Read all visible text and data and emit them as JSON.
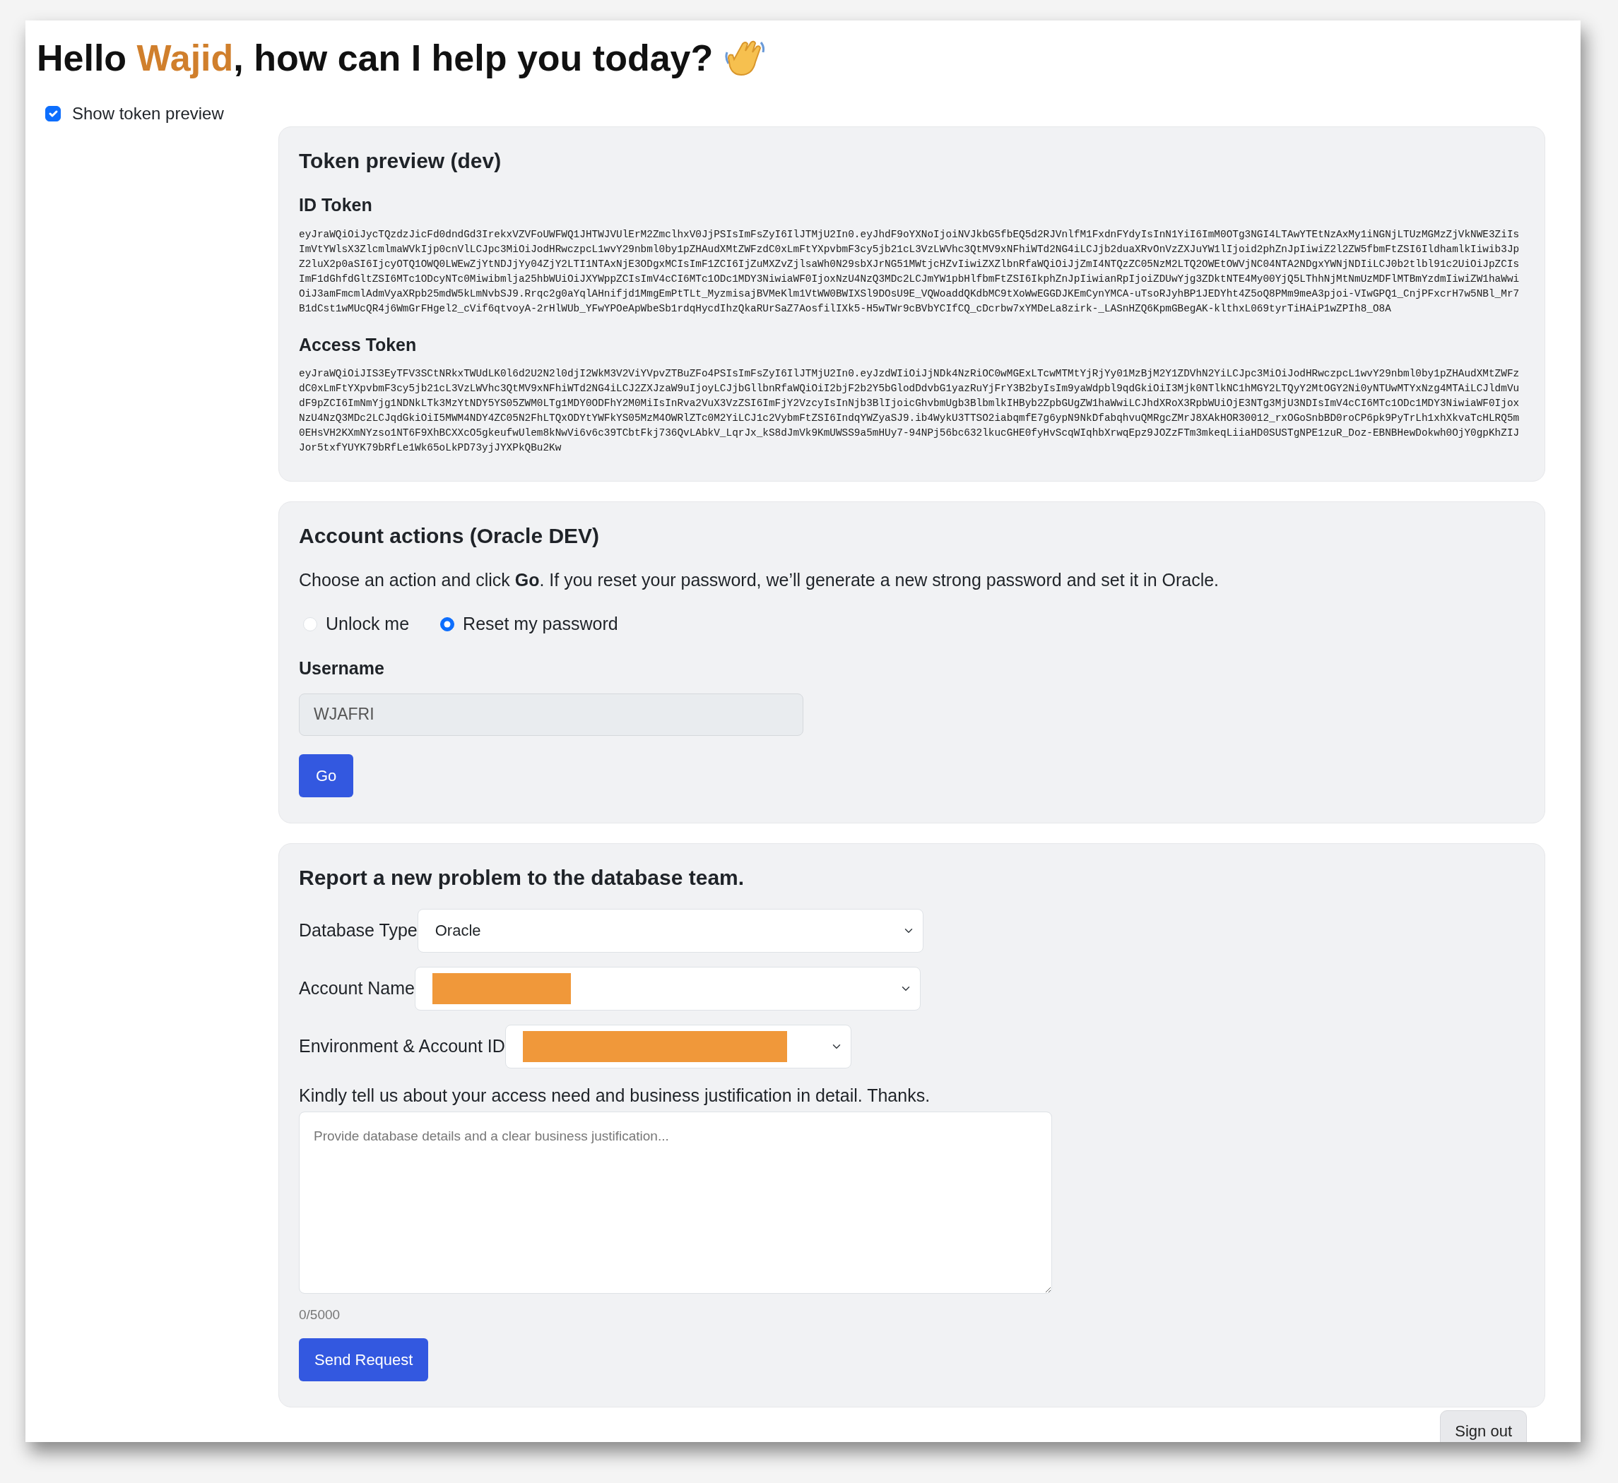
{
  "greeting": {
    "before": "Hello ",
    "name": "Wajid",
    "after": ", how can I help you today?"
  },
  "show_token_preview": {
    "label": "Show token preview",
    "checked": true
  },
  "token_preview": {
    "title": "Token preview (dev)",
    "tokens": [
      {
        "label": "ID Token",
        "value": "eyJraWQiOiJycTQzdzJicFd0dndGd3IrekxVZVFoUWFWQ1JHTWJVUlErM2ZmclhxV0JjPSIsImFsZyI6IlJTMjU2In0.eyJhdF9oYXNoIjoiNVJkbG5fbEQ5d2RJVnlfM1FxdnFYdyIsInN1YiI6ImM0OTg3NGI4LTAwYTEtNzAxMy1iNGNjLTUzMGMzZjVkNWE3ZiIsImVtYWlsX3ZlcmlmaWVkIjp0cnVlLCJpc3MiOiJodHRwczpcL1wvY29nbml0by1pZHAudXMtZWFzdC0xLmFtYXpvbmF3cy5jb21cL3VzLWVhc3QtMV9xNFhiWTd2NG4iLCJjb2duaXRvOnVzZXJuYW1lIjoid2phZnJpIiwiZ2l2ZW5fbmFtZSI6IldhamlkIiwib3JpZ2luX2p0aSI6IjcyOTQ1OWQ0LWEwZjYtNDJjYy04ZjY2LTI1NTAxNjE3ODgxMCIsImF1ZCI6IjZuMXZvZjlsaWh0N29sbXJrNG51MWtjcHZvIiwiZXZlbnRfaWQiOiJjZmI4NTQzZC05NzM2LTQ2OWEtOWVjNC04NTA2NDgxYWNjNDIiLCJ0b2tlbl91c2UiOiJpZCIsImF1dGhfdGltZSI6MTc1ODcyNTc0Miwibmlja25hbWUiOiJXYWppZCIsImV4cCI6MTc1ODc1MDY3NiwiaWF0IjoxNzU4NzQ3MDc2LCJmYW1pbHlfbmFtZSI6IkphZnJpIiwianRpIjoiZDUwYjg3ZDktNTE4My00YjQ5LThhNjMtNmUzMDFlMTBmYzdmIiwiZW1haWwiOiJ3amFmcmlAdmVyaXRpb25mdW5kLmNvbSJ9.Rrqc2g0aYqlAHnifjd1MmgEmPtTLt_MyzmisajBVMeKlm1VtWW0BWIXSl9DOsU9E_VQWoaddQKdbMC9tXoWwEGGDJKEmCynYMCA-uTsoRJyhBP1JEDYht4Z5oQ8PMm9meA3pjoi-VIwGPQ1_CnjPFxcrH7w5NBl_Mr7B1dCst1wMUcQR4j6WmGrFHgel2_cVif6qtvoyA-2rHlWUb_YFwYPOeApWbeSb1rdqHycdIhzQkaRUrSaZ7AosfilIXk5-H5wTWr9cBVbYCIfCQ_cDcrbw7xYMDeLa8zirk-_LASnHZQ6KpmGBegAK-klthxL069tyrTiHAiP1wZPIh8_O8A"
      },
      {
        "label": "Access Token",
        "value": "eyJraWQiOiJIS3EyTFV3SCtNRkxTWUdLK0l6d2U2N2l0djI2WkM3V2ViYVpvZTBuZFo4PSIsImFsZyI6IlJTMjU2In0.eyJzdWIiOiJjNDk4NzRiOC0wMGExLTcwMTMtYjRjYy01MzBjM2Y1ZDVhN2YiLCJpc3MiOiJodHRwczpcL1wvY29nbml0by1pZHAudXMtZWFzdC0xLmFtYXpvbmF3cy5jb21cL3VzLWVhc3QtMV9xNFhiWTd2NG4iLCJ2ZXJzaW9uIjoyLCJjbGllbnRfaWQiOiI2bjF2b2Y5bGlodDdvbG1yazRuYjFrY3B2byIsIm9yaWdpbl9qdGkiOiI3Mjk0NTlkNC1hMGY2LTQyY2MtOGY2Ni0yNTUwMTYxNzg4MTAiLCJldmVudF9pZCI6ImNmYjg1NDNkLTk3MzYtNDY5YS05ZWM0LTg1MDY0ODFhY2M0MiIsInRva2VuX3VzZSI6ImFjY2VzcyIsInNjb3BlIjoicGhvbmUgb3BlbmlkIHByb2ZpbGUgZW1haWwiLCJhdXRoX3RpbWUiOjE3NTg3MjU3NDIsImV4cCI6MTc1ODc1MDY3NiwiaWF0IjoxNzU4NzQ3MDc2LCJqdGkiOiI5MWM4NDY4ZC05N2FhLTQxODYtYWFkYS05MzM4OWRlZTc0M2YiLCJ1c2VybmFtZSI6IndqYWZyaSJ9.ib4WykU3TTSO2iabqmfE7g6ypN9NkDfabqhvuQMRgcZMrJ8XAkHOR30012_rxOGoSnbBD0roCP6pk9PyTrLh1xhXkvaTcHLRQ5m0EHsVH2KXmNYzso1NT6F9XhBCXXcO5gkeufwUlem8kNwVi6v6c39TCbtFkj736QvLAbkV_LqrJx_kS8dJmVk9KmUWSS9a5mHUy7-94NPj56bc632lkucGHE0fyHvScqWIqhbXrwqEpz9JOZzFTm3mkeqLiiaHD0SUSTgNPE1zuR_Doz-EBNBHewDokwh0OjY0gpKhZIJJor5txfYUYK79bRfLe1Wk65oLkPD73yjJYXPkQBu2Kw"
      }
    ]
  },
  "account_actions": {
    "title": "Account actions (Oracle DEV)",
    "instruction": "Choose an action and click **Go**. If you reset your password, we’ll generate a new strong password and set it in Oracle.",
    "options": [
      {
        "label": "Unlock me",
        "selected": false
      },
      {
        "label": "Reset my password",
        "selected": true
      }
    ],
    "username": {
      "label": "Username",
      "value": "WJAFRI",
      "disabled": true
    },
    "button": "Go"
  },
  "report": {
    "title": "Report a new problem to the database team.",
    "fields": [
      {
        "label": "Database Type",
        "kind": "select",
        "value": "Oracle"
      },
      {
        "label": "Account Name",
        "kind": "redacted"
      },
      {
        "label": "Environment & Account ID",
        "kind": "redacted"
      }
    ],
    "justification": {
      "label": "Kindly tell us about your access need and business justification in detail. Thanks.",
      "placeholder": "Provide database details and a clear business justification...",
      "counter": "0/5000"
    },
    "button": "Send Request"
  },
  "sign_out": "Sign out"
}
